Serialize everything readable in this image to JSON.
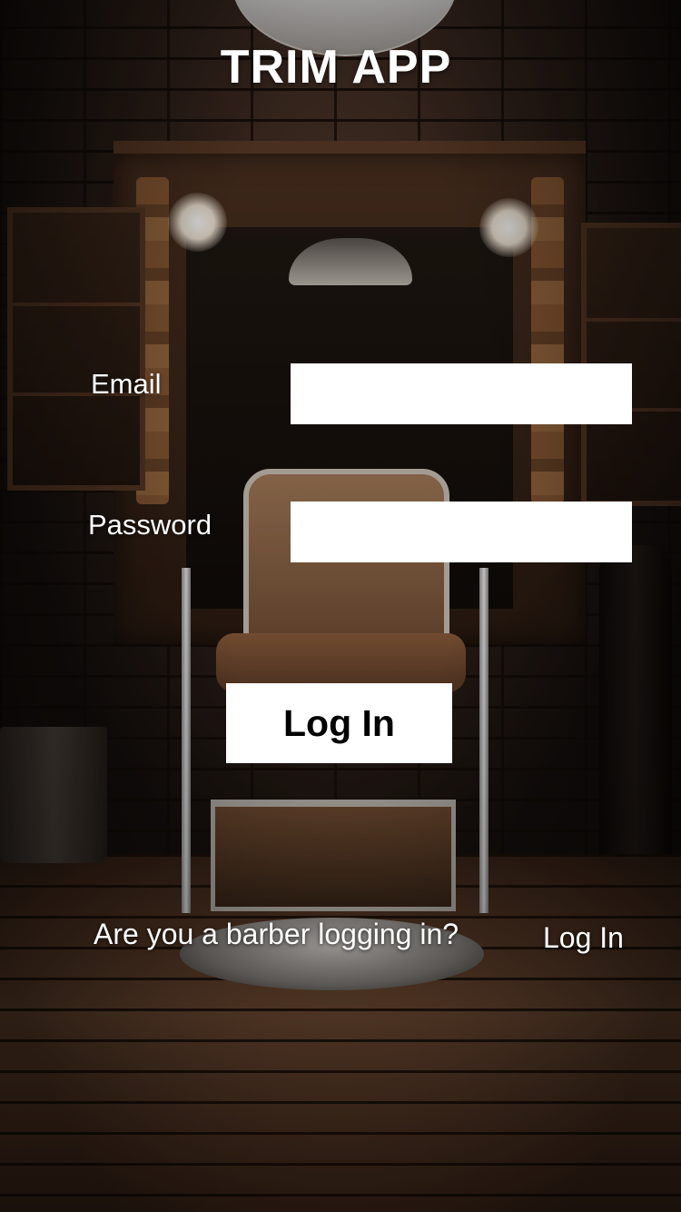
{
  "app": {
    "title": "TRIM APP"
  },
  "form": {
    "email_label": "Email",
    "email_value": "",
    "email_placeholder": "",
    "password_label": "Password",
    "password_value": "",
    "password_placeholder": "",
    "login_button_label": "Log In"
  },
  "barber": {
    "question": "Are you a barber logging in?",
    "login_link_label": "Log In"
  },
  "background": {
    "description_icon": "barbershop-background-image"
  }
}
